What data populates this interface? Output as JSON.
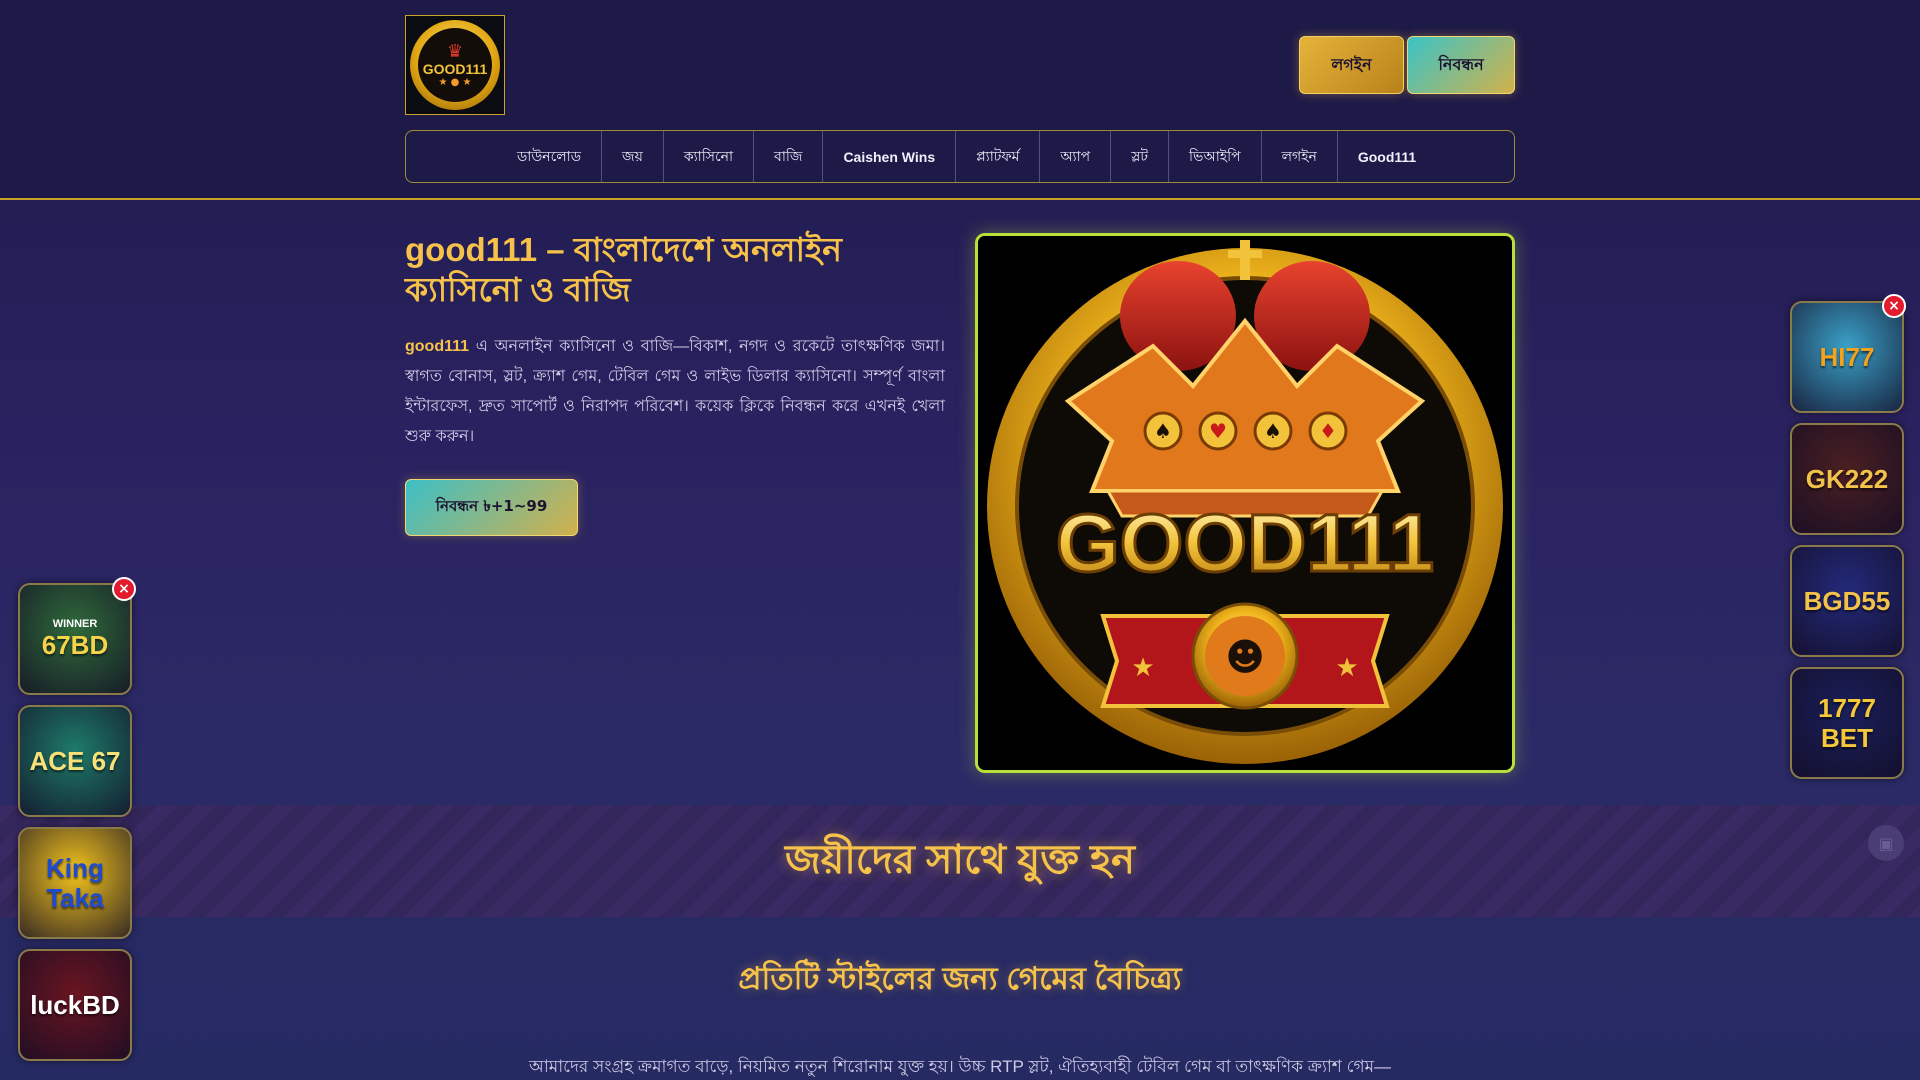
{
  "header": {
    "logo_text": "GOOD111",
    "login_label": "লগইন",
    "register_label": "নিবন্ধন"
  },
  "nav": {
    "items": [
      {
        "label": "ডাউনলোড",
        "bold": false
      },
      {
        "label": "জয়",
        "bold": false
      },
      {
        "label": "ক্যাসিনো",
        "bold": false
      },
      {
        "label": "বাজি",
        "bold": false
      },
      {
        "label": "Caishen Wins",
        "bold": true
      },
      {
        "label": "প্ল্যাটফর্ম",
        "bold": false
      },
      {
        "label": "অ্যাপ",
        "bold": false
      },
      {
        "label": "স্লট",
        "bold": false
      },
      {
        "label": "ভিআইপি",
        "bold": false
      },
      {
        "label": "লগইন",
        "bold": false
      },
      {
        "label": "Good111",
        "bold": true
      }
    ]
  },
  "hero": {
    "title": "good111 – বাংলাদেশে অনলাইন ক্যাসিনো ও বাজি",
    "brand": "good111",
    "text": " এ অনলাইন ক্যাসিনো ও বাজি—বিকাশ, নগদ ও রকেটে তাৎক্ষণিক জমা। স্বাগত বোনাস, স্লট, ক্র্যাশ গেম, টেবিল গেম ও লাইভ ডিলার ক্যাসিনো। সম্পূর্ণ বাংলা ইন্টারফেস, দ্রুত সাপোর্ট ও নিরাপদ পরিবেশ। কয়েক ক্লিকে নিবন্ধন করে এখনই খেলা শুরু করুন।",
    "cta_label": "নিবন্ধন ৳+1~99",
    "image_text": "GOOD111"
  },
  "banner": {
    "title": "জয়ীদের সাথে যুক্ত হন"
  },
  "section": {
    "title": "প্রতিটি স্টাইলের জন্য গেমের বৈচিত্র্য",
    "text": "আমাদের সংগ্রহ ক্রমাগত বাড়ে, নিয়মিত নতুন শিরোনাম যুক্ত হয়। উচ্চ RTP স্লট, ঐতিহ্যবাহী টেবিল গেম বা তাৎক্ষণিক ক্র্যাশ গেম—"
  },
  "ads_left": [
    {
      "label": "67BD",
      "sub": "WINNER",
      "bg": "#2f6a3a",
      "fg": "#f6d34a"
    },
    {
      "label": "ACE 67",
      "sub": "",
      "bg": "#1e7a6a",
      "fg": "#f7e27a"
    },
    {
      "label": "King Taka",
      "sub": "",
      "bg": "#f2c31d",
      "fg": "#1f4bd1"
    },
    {
      "label": "luckBD",
      "sub": "",
      "bg": "#6a1520",
      "fg": "#ffffff"
    }
  ],
  "ads_right": [
    {
      "label": "HI77",
      "sub": "",
      "bg": "#3aa0c8",
      "fg": "#f2a21b"
    },
    {
      "label": "GK222",
      "sub": "",
      "bg": "#4a1f22",
      "fg": "#f2c24a"
    },
    {
      "label": "BGD55",
      "sub": "",
      "bg": "#232a7a",
      "fg": "#f2c24a"
    },
    {
      "label": "1777 BET",
      "sub": "",
      "bg": "#1a1f5a",
      "fg": "#f5c83a"
    }
  ],
  "close_symbol": "×"
}
